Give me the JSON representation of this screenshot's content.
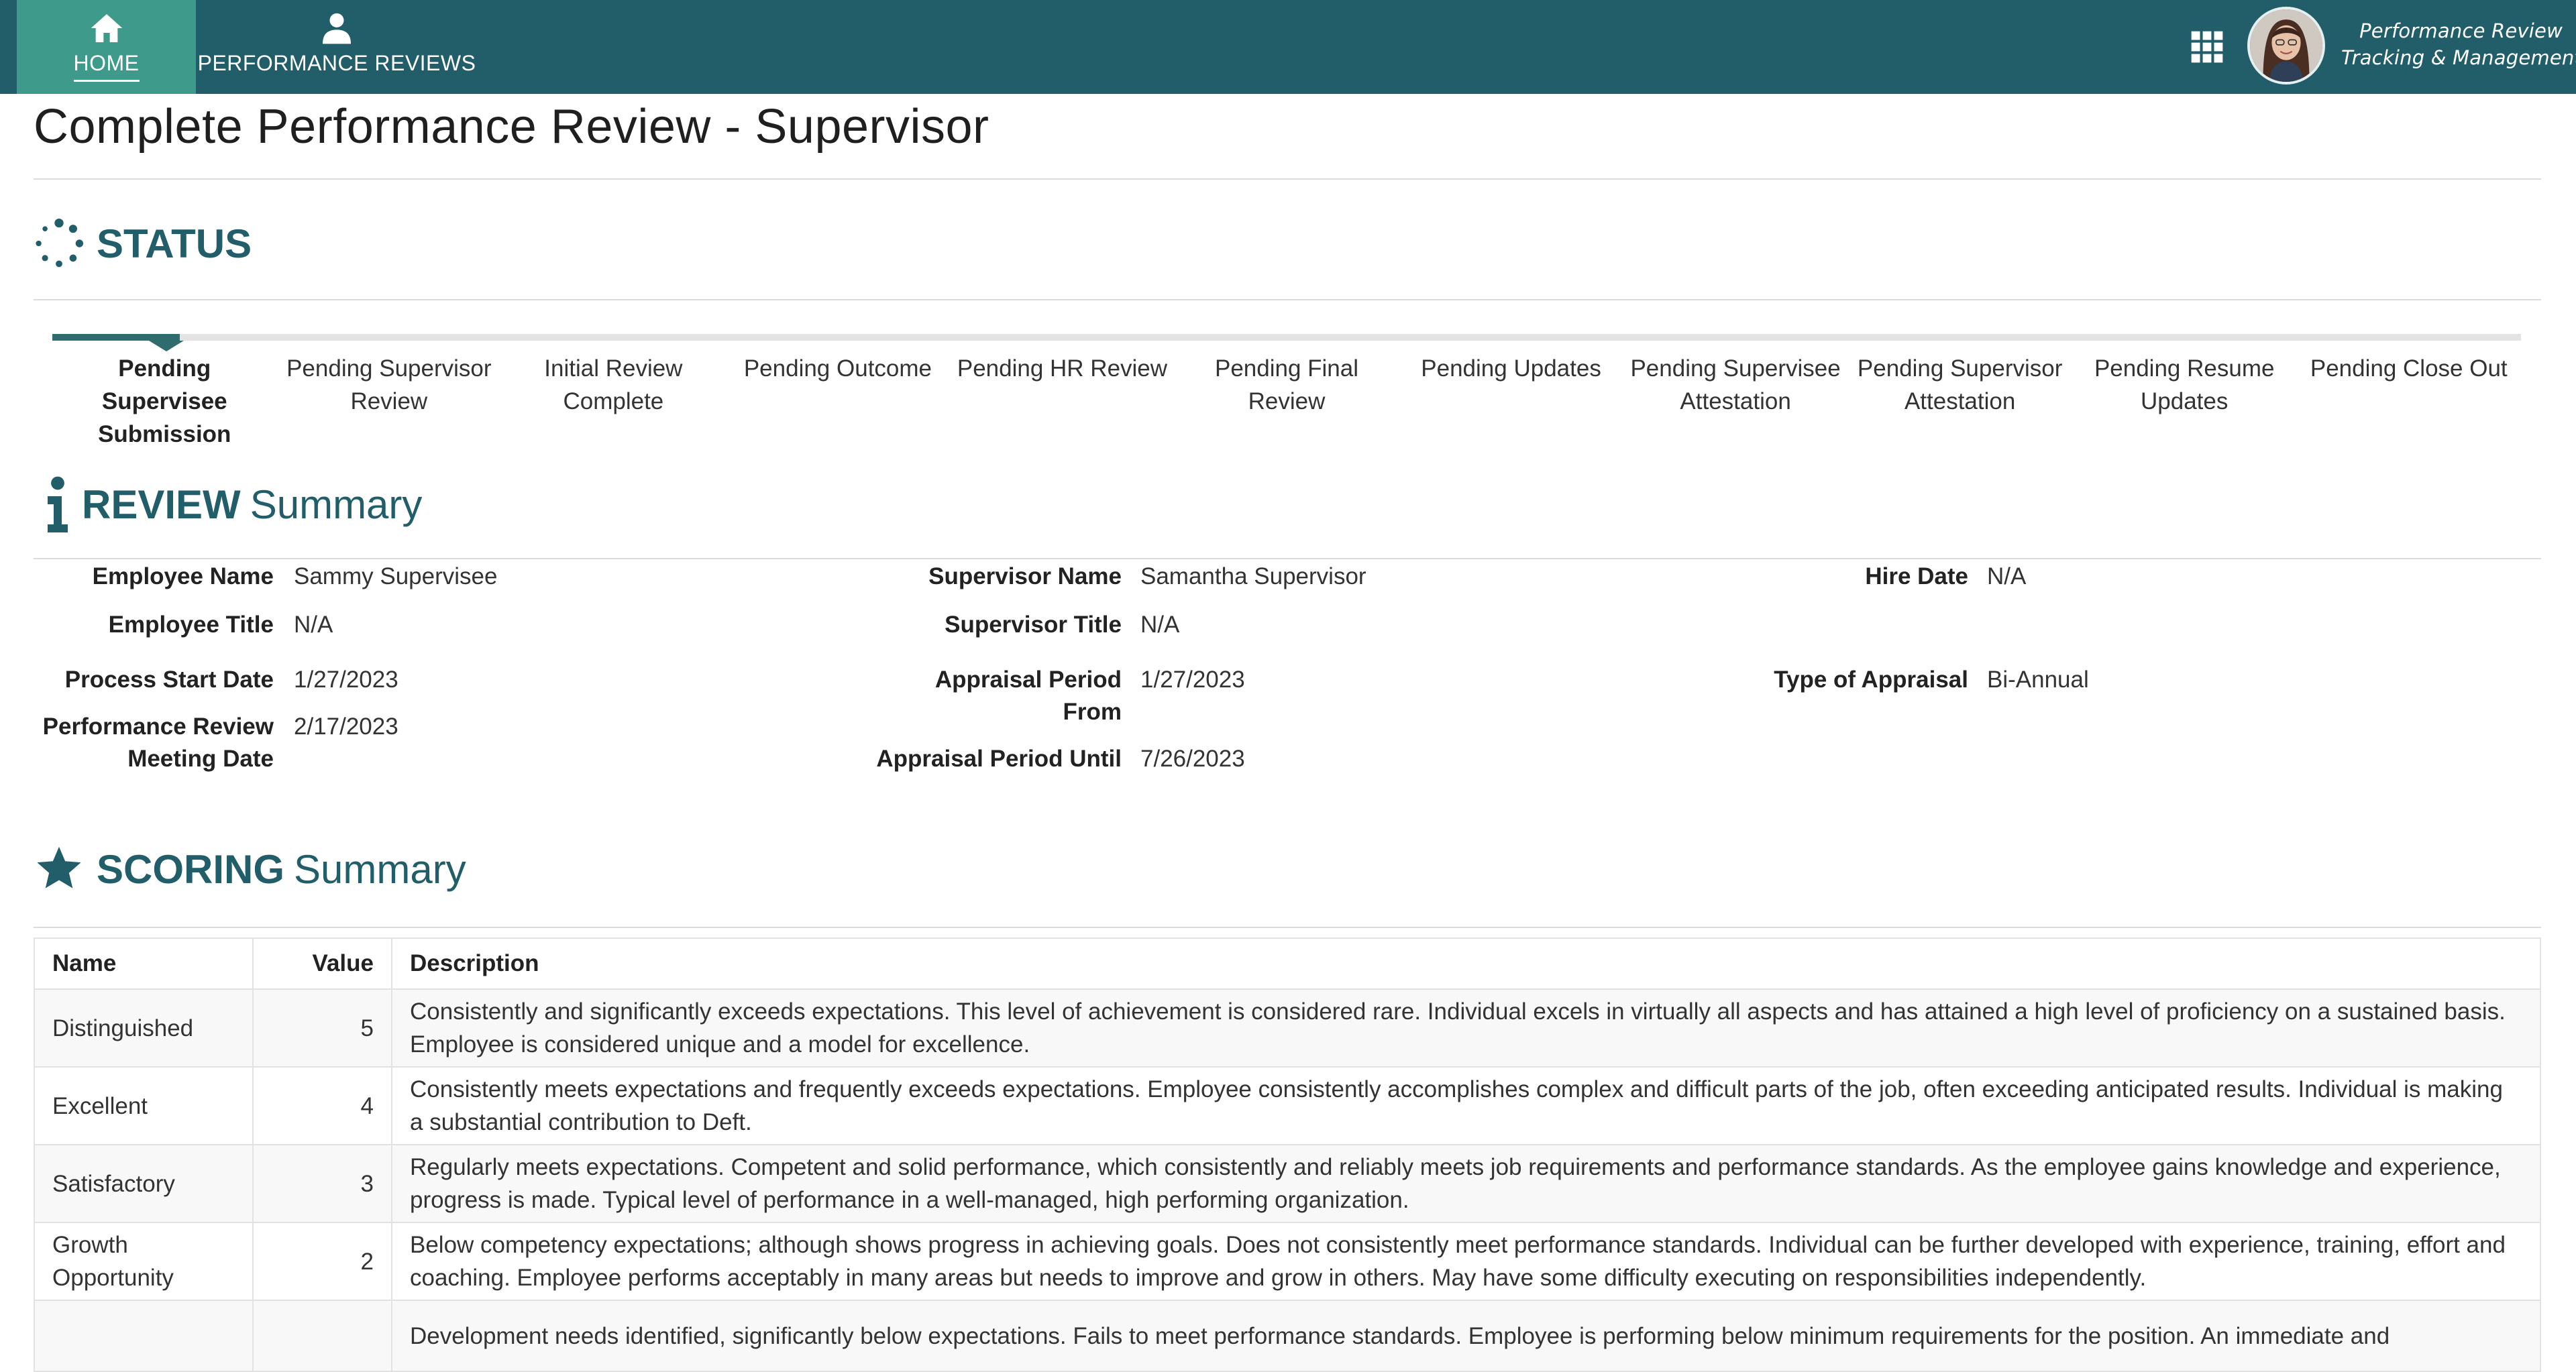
{
  "nav": {
    "home_label": "HOME",
    "reviews_label": "PERFORMANCE REVIEWS",
    "apps_icon": "grid-icon",
    "brand_line1": "Performance Review",
    "brand_line2": "Tracking & Management"
  },
  "page": {
    "title": "Complete Performance Review - Supervisor"
  },
  "status": {
    "heading": "STATUS",
    "steps": [
      "Pending Supervisee Submission",
      "Pending Supervisor Review",
      "Initial Review Complete",
      "Pending Outcome",
      "Pending HR Review",
      "Pending Final Review",
      "Pending Updates",
      "Pending Supervisee Attestation",
      "Pending Supervisor Attestation",
      "Pending Resume Updates",
      "Pending Close Out"
    ],
    "active_index": 0
  },
  "review": {
    "heading_bold": "REVIEW",
    "heading_light": "Summary",
    "employee_name_label": "Employee Name",
    "employee_name": "Sammy Supervisee",
    "employee_title_label": "Employee Title",
    "employee_title": "N/A",
    "process_start_label": "Process Start Date",
    "process_start": "1/27/2023",
    "meeting_date_label": "Performance Review Meeting Date",
    "meeting_date": "2/17/2023",
    "supervisor_name_label": "Supervisor Name",
    "supervisor_name": "Samantha Supervisor",
    "supervisor_title_label": "Supervisor Title",
    "supervisor_title": "N/A",
    "period_from_label": "Appraisal Period From",
    "period_from": "1/27/2023",
    "period_until_label": "Appraisal Period Until",
    "period_until": "7/26/2023",
    "hire_date_label": "Hire Date",
    "hire_date": "N/A",
    "appraisal_type_label": "Type of Appraisal",
    "appraisal_type": "Bi-Annual"
  },
  "scoring": {
    "heading_bold": "SCORING",
    "heading_light": "Summary",
    "columns": [
      "Name",
      "Value",
      "Description"
    ],
    "rows": [
      {
        "name": "Distinguished",
        "value": "5",
        "description": "Consistently and significantly exceeds expectations. This level of achievement is considered rare. Individual excels in virtually all aspects and has attained a high level of proficiency on a sustained basis. Employee is considered unique and a model for excellence."
      },
      {
        "name": "Excellent",
        "value": "4",
        "description": "Consistently meets expectations and frequently exceeds expectations. Employee consistently accomplishes complex and difficult parts of the job, often exceeding anticipated results. Individual is making a substantial contribution to Deft."
      },
      {
        "name": "Satisfactory",
        "value": "3",
        "description": "Regularly meets expectations. Competent and solid performance, which consistently and reliably meets job requirements and performance standards. As the employee gains knowledge and experience, progress is made. Typical level of performance in a well-managed, high performing organization."
      },
      {
        "name": "Growth Opportunity",
        "value": "2",
        "description": "Below competency expectations; although shows progress in achieving goals. Does not consistently meet performance standards. Individual can be further developed with experience, training, effort and coaching. Employee performs acceptably in many areas but needs to improve and grow in others. May have some difficulty executing on responsibilities independently."
      },
      {
        "name": "",
        "value": "",
        "description": "Development needs identified, significantly below expectations. Fails to meet performance standards. Employee is performing below minimum requirements for the position. An immediate and"
      }
    ]
  },
  "colors": {
    "topbar": "#215e6a",
    "home_active": "#3e9b8c",
    "accent": "#215e6a",
    "tracker_active": "#2f6c6d"
  }
}
